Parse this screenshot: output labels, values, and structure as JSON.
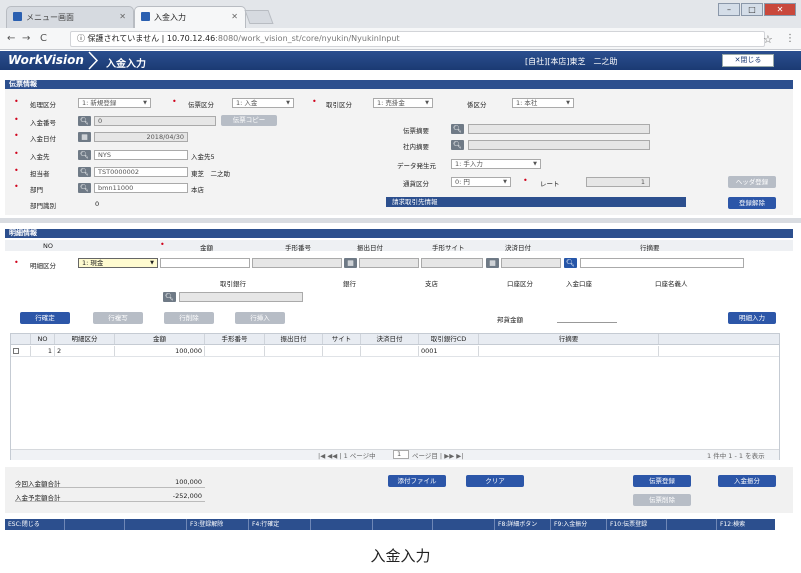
{
  "browser": {
    "tabs": [
      {
        "label": "メニュー画面"
      },
      {
        "label": "入金入力"
      }
    ],
    "url_prefix": "保護されていません",
    "url_host": "10.70.12.46",
    "url_path": ":8080/work_vision_st/core/nyukin/NyukinInput",
    "star": "☆"
  },
  "app": {
    "logo": "WorkVision",
    "title": "入金入力",
    "user": "[自社][本店]東芝　二之助",
    "close_label": "✕閉じる"
  },
  "voucher": {
    "section_title": "伝票情報",
    "shori_label": "処理区分",
    "shori_value": "1: 新規登録",
    "denpyo_kubun_label": "伝票区分",
    "denpyo_kubun_value": "1: 入金",
    "torihiki_kubun_label": "取引区分",
    "torihiki_kubun_value": "1: 売掛金",
    "kei_label": "係区分",
    "kei_value": "1: 本社",
    "nyukin_no_label": "入金番号",
    "nyukin_no_value": "0",
    "copy_label": "伝票コピー",
    "date_label": "入金日付",
    "date_value": "2018/04/30",
    "nyukinsaki_label": "入金先",
    "nyukinsaki_code": "NYS",
    "nyukinsaki_name": "入金先5",
    "tanto_label": "担当者",
    "tanto_code": "TST0000002",
    "tanto_name": "東芝　二之助",
    "bumon_label": "部門",
    "bumon_code": "bmn11000",
    "bumon_name": "本店",
    "bumon_shikibetsu_label": "部門識別",
    "bumon_shikibetsu_value": "0",
    "tekiyo_label": "伝票摘要",
    "shanai_label": "社内摘要",
    "data_label": "データ発生元",
    "data_value": "1: 手入力",
    "tsuka_label": "通貨区分",
    "tsuka_value": "0: 円",
    "rate_label": "レート",
    "rate_value": "1",
    "seikyu_label": "請求取引先情報",
    "header_register": "ヘッダ登録",
    "register_release": "登録解除"
  },
  "detail": {
    "section_title": "明細情報",
    "col_no": "NO",
    "col_kingaku": "金額",
    "col_tegata": "手形番号",
    "col_furidashi": "振出日付",
    "col_site": "手形サイト",
    "col_kessai": "決済日付",
    "col_tekiyo": "行摘要",
    "meisai_label": "明細区分",
    "meisai_value": "1: 現金",
    "torihiki_bank": "取引銀行",
    "bank": "銀行",
    "shiten": "支店",
    "koza_kubun": "口座区分",
    "nyukin_koza": "入金口座",
    "koza_meigi": "口座名義人",
    "btn_confirm": "行確定",
    "btn_copy": "行複写",
    "btn_delete": "行削除",
    "btn_insert": "行挿入",
    "hojin_label": "邦貨金額",
    "btn_detail_input": "明細入力"
  },
  "grid": {
    "headers": [
      "NO",
      "明細区分",
      "金額",
      "手形番号",
      "振出日付",
      "サイト",
      "決済日付",
      "取引銀行CD",
      "行摘要"
    ],
    "rows": [
      [
        "1",
        "2",
        "100,000",
        "",
        "",
        "",
        "",
        "0001",
        ""
      ]
    ],
    "pager_prefix": "|◀ ◀◀ | 1 ページ中",
    "pager_page": "1",
    "pager_suffix": "ページ目 | ▶▶ ▶|",
    "count_info": "1 件中 1 - 1 を表示"
  },
  "totals": {
    "konkai_label": "今回入金額合計",
    "konkai_value": "100,000",
    "yotei_label": "入金予定額合計",
    "yotei_value": "-252,000"
  },
  "actions": {
    "attach": "添付ファイル",
    "clear": "クリア",
    "register": "伝票登録",
    "delete": "伝票削除",
    "nyukin_bun": "入金振分"
  },
  "fkeys": [
    "ESC:閉じる",
    "",
    "",
    "F3:登録解除",
    "F4:行確定",
    "",
    "",
    "",
    "F8:詳細ボタン",
    "F9:入金振分",
    "F10:伝票登録",
    "",
    "F12:検索"
  ],
  "caption": "入金入力"
}
